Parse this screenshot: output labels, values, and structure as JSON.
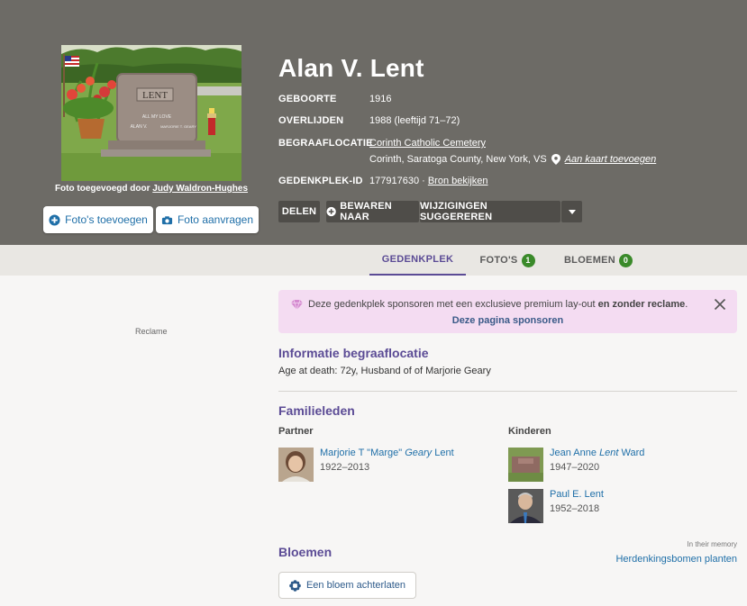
{
  "photo": {
    "credit_prefix": "Foto toegevoegd door",
    "credit_name": "Judy Waldron-Hughes",
    "stone_name": "LENT",
    "stone_left": "ALAN V.",
    "stone_right": "MARJORIE T. GEARY",
    "stone_center": "ALL MY LOVE"
  },
  "photo_buttons": {
    "add": "Foto's toevoegen",
    "request": "Foto aanvragen"
  },
  "memorial": {
    "name": "Alan V. Lent",
    "birth_label": "GEBOORTE",
    "birth_value": "1916",
    "death_label": "OVERLIJDEN",
    "death_value": "1988 (leeftijd 71–72)",
    "burial_label": "BEGRAAFLOCATIE",
    "cemetery": "Corinth Catholic Cemetery",
    "location": "Corinth, Saratoga County, New York, VS",
    "map_link": "Aan kaart toevoegen",
    "id_label": "GEDENKPLEK-ID",
    "id_value": "177917630",
    "id_sep": " · ",
    "source_link": "Bron bekijken"
  },
  "actions": {
    "share": "DELEN",
    "save": "BEWAREN NAAR",
    "suggest": "WIJZIGINGEN SUGGEREREN"
  },
  "tabs": [
    {
      "label": "GEDENKPLEK"
    },
    {
      "label": "FOTO'S",
      "count": "1"
    },
    {
      "label": "BLOEMEN",
      "count": "0"
    }
  ],
  "ad_label": "Reclame",
  "sponsor": {
    "text": "Deze gedenkplek sponsoren met een exclusieve premium lay-out",
    "bold": "en zonder reclame",
    "end": ".",
    "link": "Deze pagina sponsoren"
  },
  "burial_info": {
    "heading": "Informatie begraaflocatie",
    "text": "Age at death: 72y, Husband of of Marjorie Geary"
  },
  "family": {
    "heading": "Familieleden",
    "partner_label": "Partner",
    "children_label": "Kinderen",
    "partner": {
      "first": "Marjorie T \"Marge\" ",
      "italic": "Geary",
      "last": " Lent",
      "dates": "1922–2013"
    },
    "children": [
      {
        "first": "Jean Anne ",
        "italic": "Lent",
        "last": " Ward",
        "dates": "1947–2020"
      },
      {
        "first": "Paul E. Lent",
        "italic": "",
        "last": "",
        "dates": "1952–2018"
      }
    ]
  },
  "flowers": {
    "heading": "Bloemen",
    "memory": "In their memory",
    "trees_link": "Herdenkingsbomen planten",
    "leave_button": "Een bloem achterlaten"
  },
  "colors": {
    "hero": "#6d6b66",
    "accent": "#5b4b95",
    "link": "#1f6fa8",
    "badge": "#3a8a2a",
    "sponsor_bg": "#f4dcf2"
  }
}
